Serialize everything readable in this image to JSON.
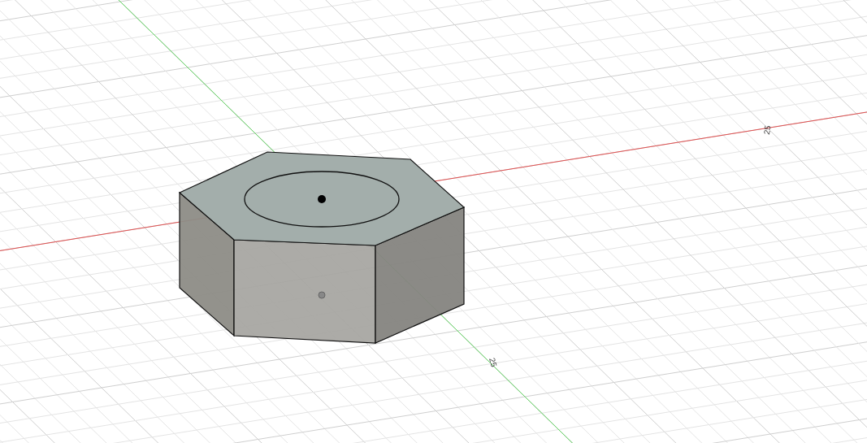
{
  "viewport": {
    "axis_labels": [
      {
        "text": "25"
      },
      {
        "text": "25"
      }
    ]
  }
}
